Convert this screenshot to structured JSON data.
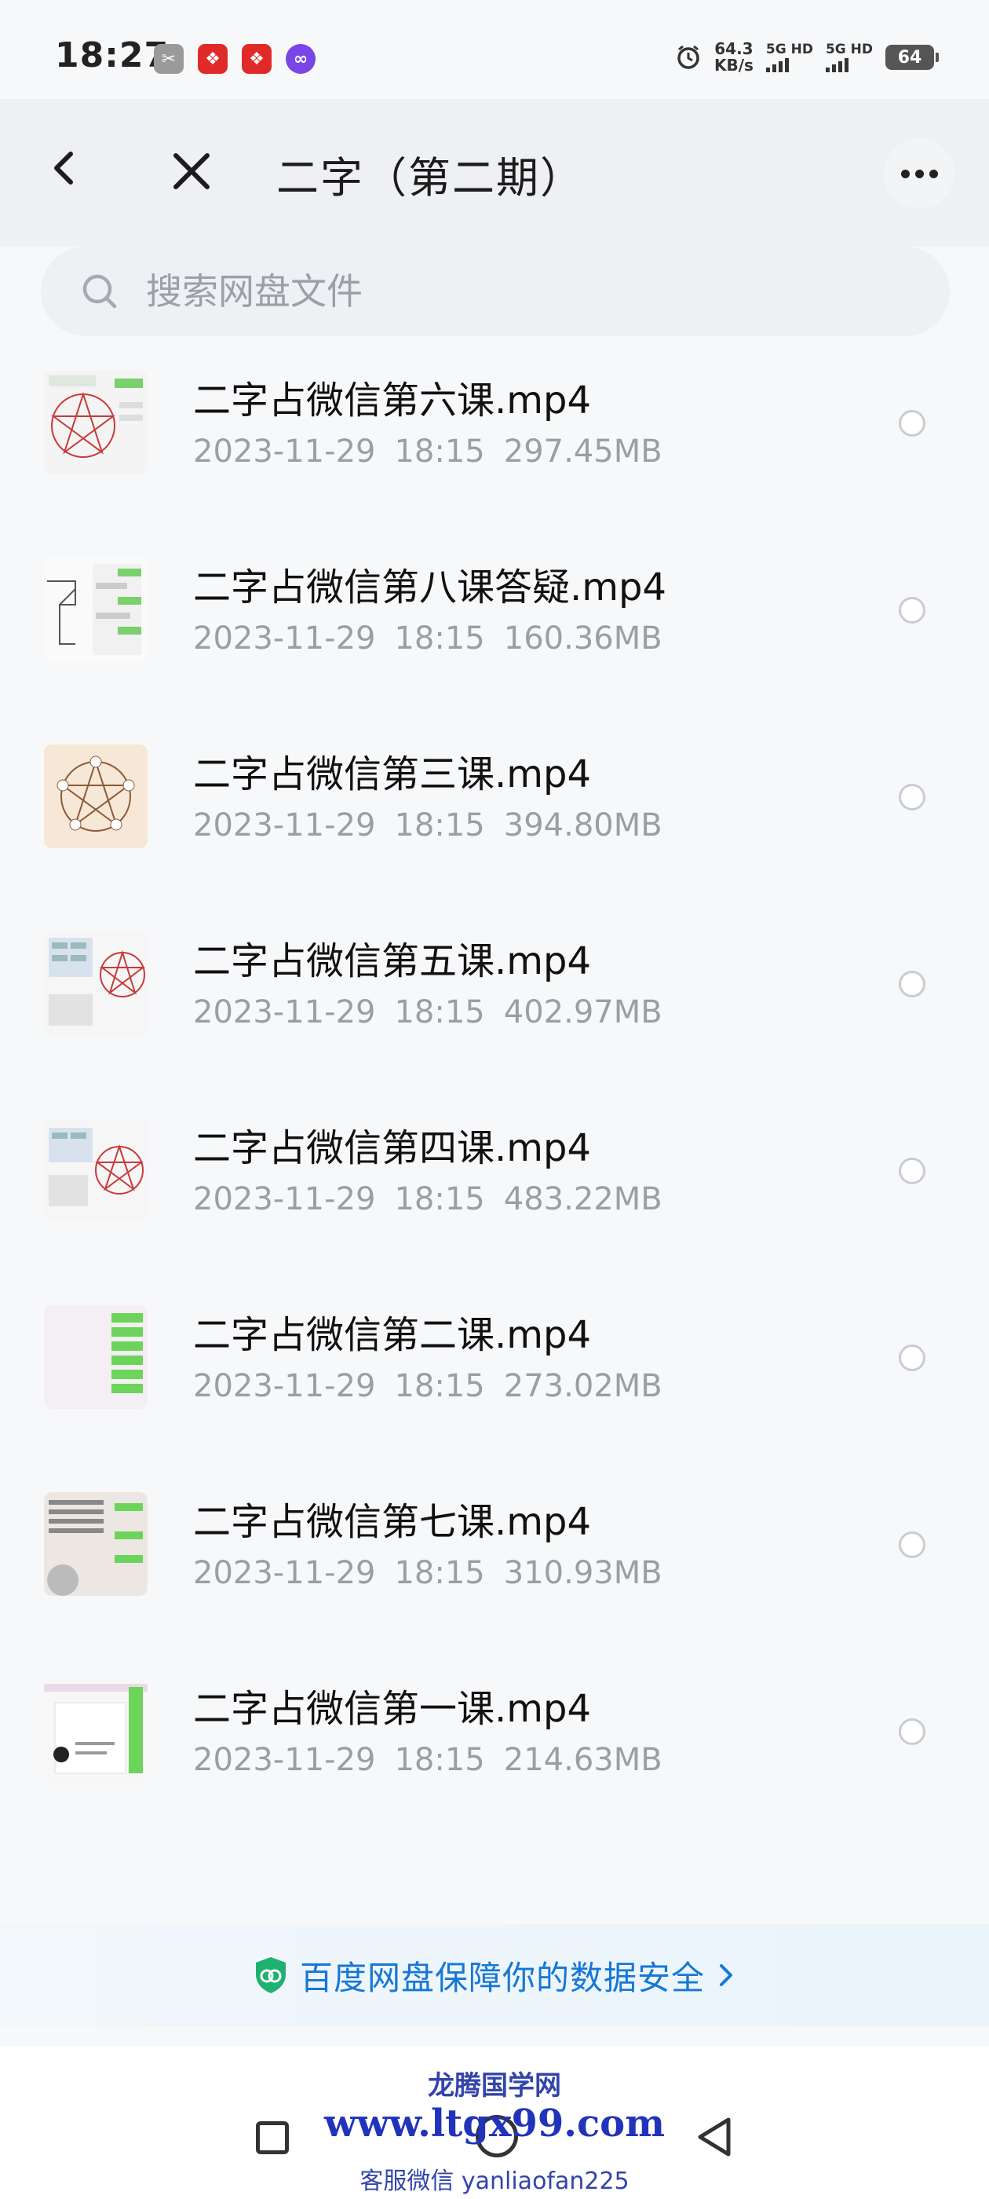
{
  "status_bar": {
    "time": "18:27",
    "net_speed_value": "64.3",
    "net_speed_unit": "KB/s",
    "sim1": "5G HD",
    "sim2": "5G HD",
    "battery": "64"
  },
  "header": {
    "title": "二字（第二期）",
    "back_icon": "chevron-left-icon",
    "close_icon": "close-icon",
    "more_icon": "more-dots-icon"
  },
  "search": {
    "placeholder": "搜索网盘文件",
    "icon": "search-icon"
  },
  "files": [
    {
      "name": "二字占微信第六课.mp4",
      "date": "2023-11-29",
      "time": "18:15",
      "size": "297.45MB",
      "thumb": "pentagram-diagram"
    },
    {
      "name": "二字占微信第八课答疑.mp4",
      "date": "2023-11-29",
      "time": "18:15",
      "size": "160.36MB",
      "thumb": "chat-sketch"
    },
    {
      "name": "二字占微信第三课.mp4",
      "date": "2023-11-29",
      "time": "18:15",
      "size": "394.80MB",
      "thumb": "pentagram-warm"
    },
    {
      "name": "二字占微信第五课.mp4",
      "date": "2023-11-29",
      "time": "18:15",
      "size": "402.97MB",
      "thumb": "grid-pentagram"
    },
    {
      "name": "二字占微信第四课.mp4",
      "date": "2023-11-29",
      "time": "18:15",
      "size": "483.22MB",
      "thumb": "grid-pentagram"
    },
    {
      "name": "二字占微信第二课.mp4",
      "date": "2023-11-29",
      "time": "18:15",
      "size": "273.02MB",
      "thumb": "chat-green"
    },
    {
      "name": "二字占微信第七课.mp4",
      "date": "2023-11-29",
      "time": "18:15",
      "size": "310.93MB",
      "thumb": "text-chat"
    },
    {
      "name": "二字占微信第一课.mp4",
      "date": "2023-11-29",
      "time": "18:15",
      "size": "214.63MB",
      "thumb": "doc-page"
    }
  ],
  "security_banner": {
    "text": "百度网盘保障你的数据安全",
    "icon": "shield-icon"
  },
  "watermark": {
    "line1": "龙腾国学网",
    "line2": "www.ltgx99.com",
    "line3": "客服微信 yanliaofan225"
  },
  "colors": {
    "accent": "#1677d6",
    "meta_text": "#9b9ea4"
  }
}
